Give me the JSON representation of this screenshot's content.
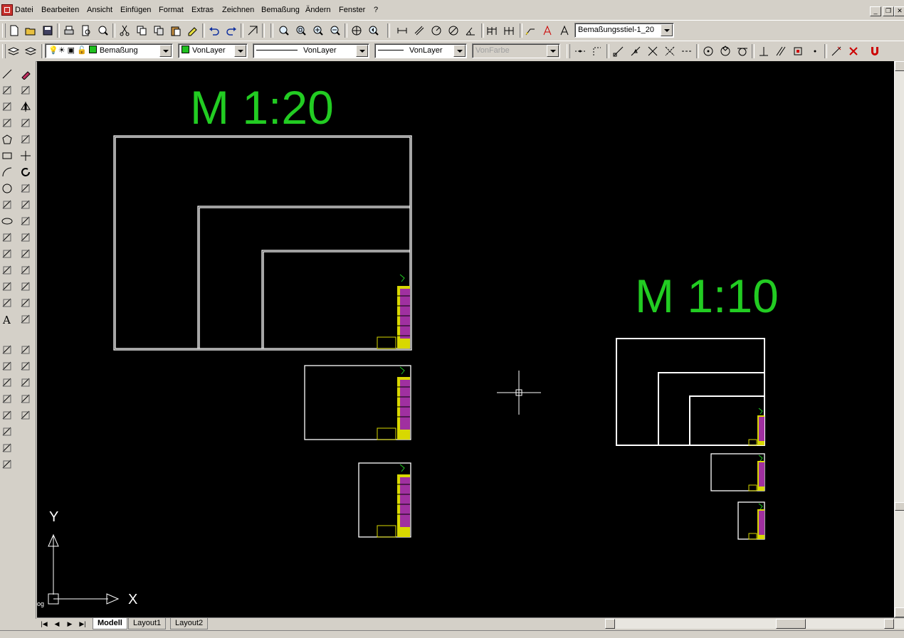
{
  "menubar": {
    "items": [
      "Datei",
      "Bearbeiten",
      "Ansicht",
      "Einfügen",
      "Format",
      "Extras",
      "Zeichnen",
      "Bemaßung",
      "Ändern",
      "Fenster",
      "?"
    ]
  },
  "toolbar_standard": {
    "dimstyle_value": "Bemaßungsstiel-1_20"
  },
  "toolbar_properties": {
    "layer_value": "Bemaßung",
    "color_value": "VonLayer",
    "linetype_value": "VonLayer",
    "lineweight_value": "VonLayer",
    "plotstyle_value": "VonFarbe"
  },
  "drawing": {
    "label_left": "M 1:20",
    "label_right": "M 1:10",
    "label_color": "#22cc22",
    "ucs_y": "Y",
    "ucs_x": "X",
    "side_fragment": "og"
  },
  "tabs": [
    "Modell",
    "Layout1",
    "Layout2"
  ],
  "active_tab": "Modell"
}
